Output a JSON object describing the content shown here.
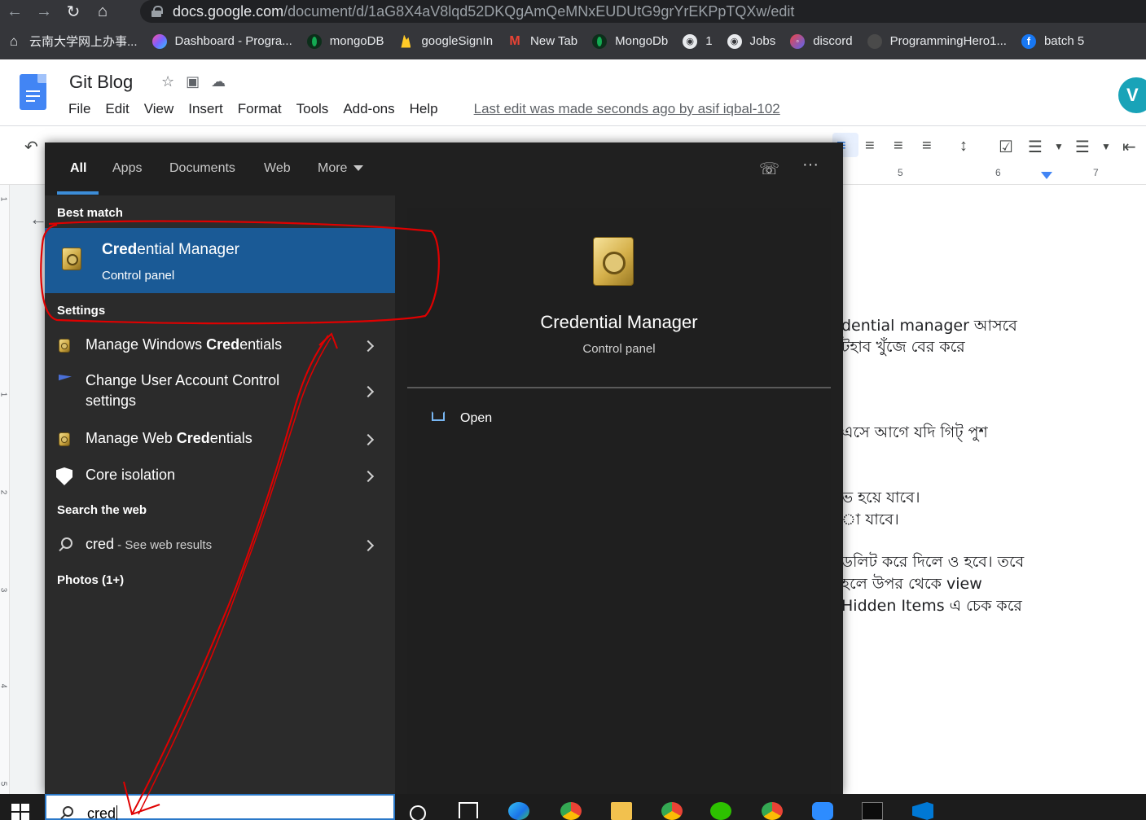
{
  "browser": {
    "url_host": "docs.google.com",
    "url_path": "/document/d/1aG8X4aV8lqd52DKQgAmQeMNxEUDUtG9grYrEKPpTQXw/edit",
    "bookmarks": [
      {
        "label": "云南大学网上办事...",
        "icon": "home-icon",
        "color": "#e8eaed"
      },
      {
        "label": "Dashboard - Progra...",
        "icon": "colorful-feather-icon",
        "color": "#c94fd8"
      },
      {
        "label": "mongoDB",
        "icon": "mongodb-leaf-icon",
        "color": "#13aa52"
      },
      {
        "label": "googleSignIn",
        "icon": "firebase-icon",
        "color": "#ffca28"
      },
      {
        "label": "New Tab",
        "icon": "gmail-icon",
        "color": "#ea4335"
      },
      {
        "label": "MongoDb",
        "icon": "mongodb-leaf-icon",
        "color": "#13aa52"
      },
      {
        "label": "1",
        "icon": "globe-icon",
        "color": "#e8eaed"
      },
      {
        "label": "Jobs",
        "icon": "globe-icon",
        "color": "#e8eaed"
      },
      {
        "label": "discord",
        "icon": "discord-icon",
        "color": "#5865f2"
      },
      {
        "label": "ProgrammingHero1...",
        "icon": "github-icon",
        "color": "#444"
      },
      {
        "label": "batch 5",
        "icon": "facebook-icon",
        "color": "#1877f2"
      }
    ]
  },
  "docs": {
    "title": "Git Blog",
    "menu": [
      "File",
      "Edit",
      "View",
      "Insert",
      "Format",
      "Tools",
      "Add-ons",
      "Help"
    ],
    "last_edit": "Last edit was made seconds ago by asif iqbal-102",
    "ruler_numbers": [
      "5",
      "6",
      "7"
    ],
    "vruler_numbers": [
      "1",
      "1",
      "2",
      "3",
      "4",
      "5"
    ],
    "body_lines": [
      "dential manager আসবে",
      "টহাব খুঁজে বের করে",
      "এসে আগে যদি গিট্‌ পুশ",
      "ভ হয়ে যাবে।",
      "া যাবে।",
      "ডলিট করে দিলে ও হবে। তবে",
      "হলে উপর থেকে view",
      "Hidden Items এ চেক করে"
    ]
  },
  "search": {
    "tabs": [
      "All",
      "Apps",
      "Documents",
      "Web",
      "More"
    ],
    "best_match_heading": "Best match",
    "best_match": {
      "title_bold": "Cred",
      "title_rest": "ential Manager",
      "subtitle": "Control panel",
      "icon": "safe-vault-icon"
    },
    "settings_heading": "Settings",
    "settings_items": [
      {
        "pre": "Manage Windows ",
        "bold": "Cred",
        "post": "entials",
        "icon": "safe-vault-icon"
      },
      {
        "pre": "Change User Account Control",
        "bold": "",
        "post": "",
        "line2": "settings",
        "icon": "uac-flag-icon"
      },
      {
        "pre": "Manage Web ",
        "bold": "Cred",
        "post": "entials",
        "icon": "safe-vault-icon"
      },
      {
        "pre": "Core isolation",
        "bold": "",
        "post": "",
        "icon": "shield-icon"
      }
    ],
    "web_heading": "Search the web",
    "web_query": "cred",
    "web_suffix": " - See web results",
    "photos_heading": "Photos (1+)",
    "preview": {
      "title": "Credential Manager",
      "subtitle": "Control panel",
      "open_label": "Open"
    },
    "query": "cred"
  },
  "colors": {
    "accent": "#1a5a96",
    "annotation": "#e00000",
    "selection_tab": "#3c8dd8"
  }
}
